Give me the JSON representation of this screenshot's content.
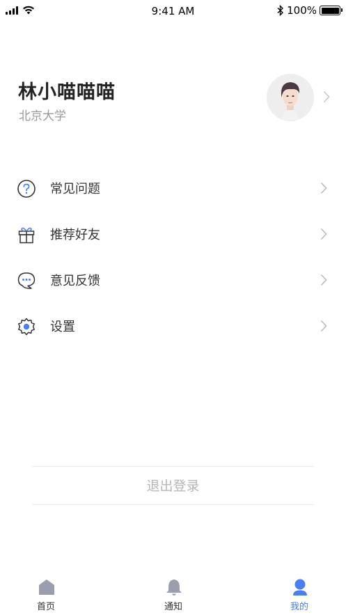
{
  "status_bar": {
    "time": "9:41 AM",
    "battery": "100%"
  },
  "profile": {
    "name": "林小喵喵喵",
    "school": "北京大学"
  },
  "menu": {
    "items": [
      {
        "label": "常见问题",
        "icon": "question-icon"
      },
      {
        "label": "推荐好友",
        "icon": "gift-icon"
      },
      {
        "label": "意见反馈",
        "icon": "chat-icon"
      },
      {
        "label": "设置",
        "icon": "gear-icon"
      }
    ]
  },
  "logout": {
    "label": "退出登录"
  },
  "tab_bar": {
    "tabs": [
      {
        "label": "首页",
        "icon": "home-icon"
      },
      {
        "label": "通知",
        "icon": "bell-icon"
      },
      {
        "label": "我的",
        "icon": "user-icon"
      }
    ],
    "active_index": 2,
    "active_color": "#4a7ff0",
    "inactive_icon_color": "#9a9eae"
  }
}
